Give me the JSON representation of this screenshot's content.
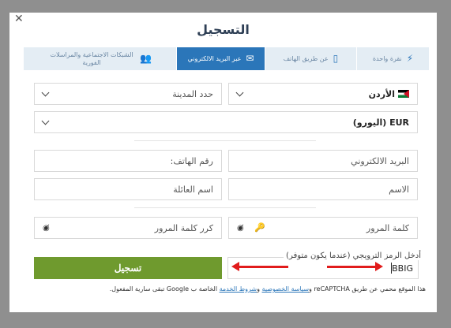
{
  "modal": {
    "title": "التسجيل",
    "close_icon": "close-icon"
  },
  "tabs": [
    {
      "label": "نقرة واحدة",
      "icon": "lightning-icon",
      "active": false
    },
    {
      "label": "عن طريق الهاتف",
      "icon": "phone-icon",
      "active": false
    },
    {
      "label": "عبر البريد الالكتروني",
      "icon": "envelope-icon",
      "active": true
    },
    {
      "label": "الشبكات الاجتماعية والمراسلات الفورية",
      "icon": "users-icon",
      "active": false
    }
  ],
  "form": {
    "country": "الأردن",
    "city_placeholder": "حدد المدينة",
    "currency": "EUR (اليورو)",
    "email_placeholder": "البريد الالكتروني",
    "phone_placeholder": "رقم الهاتف:",
    "first_name_placeholder": "الاسم",
    "last_name_placeholder": "اسم العائلة",
    "password_placeholder": "كلمة المرور",
    "confirm_password_placeholder": "كرر كلمة المرور",
    "promo_label": "أدخل الرمز الترويجي (عندما يكون متوفر)",
    "promo_value": "BBIG",
    "submit_label": "تسجيل"
  },
  "notice": {
    "prefix": "هذا الموقع محمي عن طريق reCAPTCHA و",
    "privacy_link": "سياسة الخصوصية",
    "and": " و",
    "terms_link": "شروط الخدمة",
    "suffix": " الخاصة ب Google تبقى سارية المفعول."
  },
  "colors": {
    "accent": "#2b76b9",
    "submit": "#6f9a2e",
    "annotation_arrow": "#e11c1c"
  }
}
